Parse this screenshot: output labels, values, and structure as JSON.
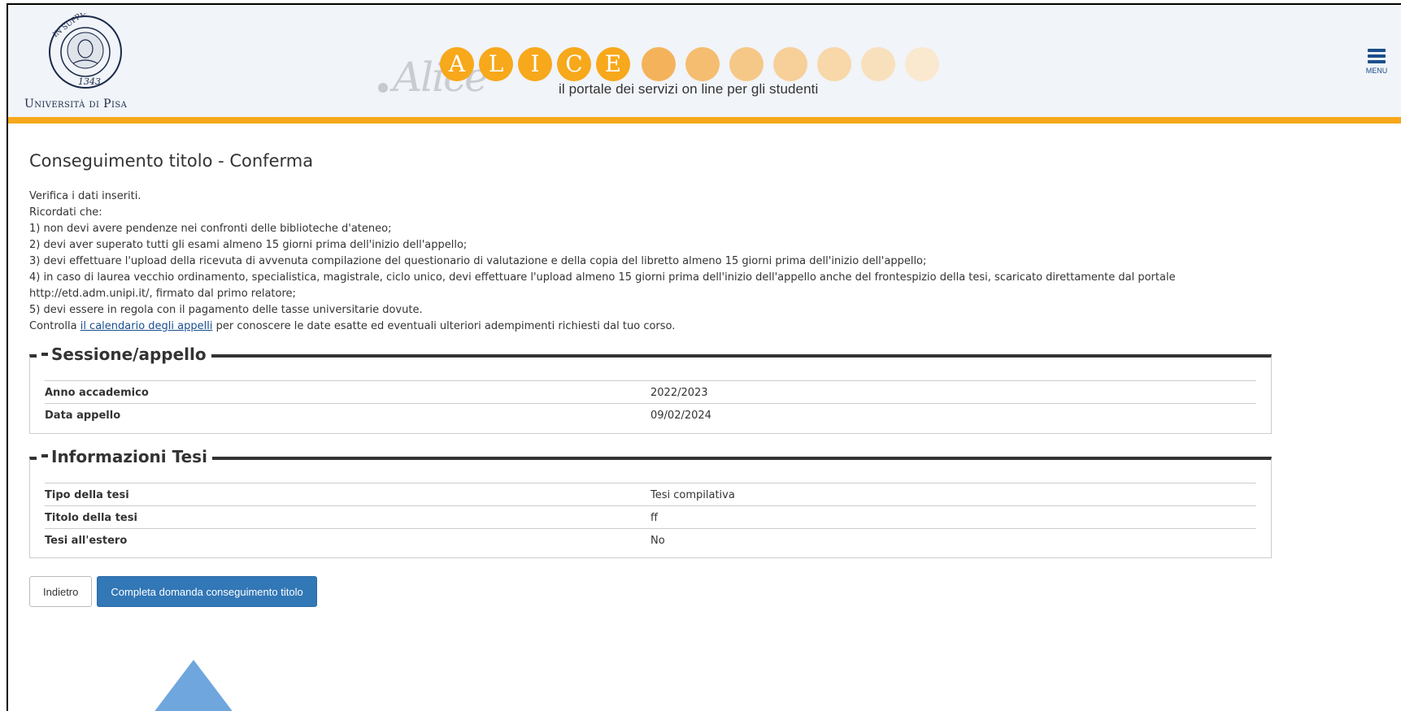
{
  "header": {
    "university_name": "Università di Pisa",
    "seal_motto": "IN SUPREMÆ DIGNITATIS",
    "seal_year": "1343",
    "portal_script": "Alice",
    "portal_letters": [
      "A",
      "L",
      "I",
      "C",
      "E"
    ],
    "tagline": "il portale dei servizi on line per gli studenti",
    "menu_label": "MENU",
    "accent_color": "#f7a81b"
  },
  "page": {
    "title": "Conseguimento titolo - Conferma",
    "intro_lines": [
      "Verifica i dati inseriti.",
      "Ricordati che:",
      "1) non devi avere pendenze nei confronti delle biblioteche d'ateneo;",
      "2) devi aver superato tutti gli esami almeno 15 giorni prima dell'inizio dell'appello;",
      "3) devi effettuare l'upload della ricevuta di avvenuta compilazione del questionario di valutazione e della copia del libretto almeno 15 giorni prima dell'inizio dell'appello;",
      "4) in caso di laurea vecchio ordinamento, specialistica, magistrale, ciclo unico, devi effettuare l'upload almeno 15 giorni prima dell'inizio dell'appello anche del frontespizio della tesi, scaricato direttamente dal portale",
      "http://etd.adm.unipi.it/, firmato dal primo relatore;",
      "5) devi essere in regola con il pagamento delle tasse universitarie dovute."
    ],
    "calendar_prefix": "Controlla ",
    "calendar_link": "il calendario degli appelli",
    "calendar_suffix": " per conoscere le date esatte ed eventuali ulteriori adempimenti richiesti dal tuo corso."
  },
  "sessione": {
    "legend": "Sessione/appello",
    "rows": [
      {
        "label": "Anno accademico",
        "value": "2022/2023"
      },
      {
        "label": "Data appello",
        "value": "09/02/2024"
      }
    ]
  },
  "tesi": {
    "legend": "Informazioni Tesi",
    "rows": [
      {
        "label": "Tipo della tesi",
        "value": "Tesi compilativa"
      },
      {
        "label": "Titolo della tesi",
        "value": "ff"
      },
      {
        "label": "Tesi all'estero",
        "value": "No"
      }
    ]
  },
  "actions": {
    "back_label": "Indietro",
    "submit_label": "Completa domanda conseguimento titolo",
    "primary_color": "#3277b6"
  },
  "annotation": {
    "arrow_color": "#6fa6de"
  }
}
